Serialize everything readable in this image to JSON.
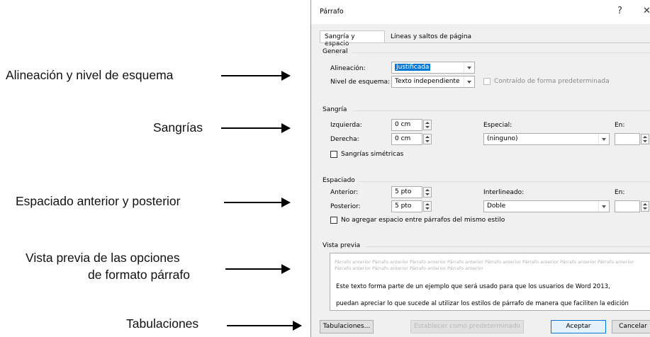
{
  "annotations": {
    "alineacion": "Alineación y nivel de esquema",
    "sangrias": "Sangrías",
    "espaciado": "Espaciado anterior y posterior",
    "vista_previa_1": "Vista previa de las opciones",
    "vista_previa_2": "de formato párrafo",
    "tabulaciones": "Tabulaciones"
  },
  "dialog": {
    "title": "Párrafo",
    "help": "?",
    "close": "✕",
    "tabs": [
      "Sangría y espacio",
      "Líneas y saltos de página"
    ],
    "general": {
      "heading": "General",
      "alineacion_label": "Alineación:",
      "alineacion_value": "Justificada",
      "nivel_label": "Nivel de esquema:",
      "nivel_value": "Texto independiente",
      "contraido_label": "Contraído de forma predeterminada"
    },
    "sangria": {
      "heading": "Sangría",
      "izquierda_label": "Izquierda:",
      "izquierda_value": "0 cm",
      "derecha_label": "Derecha:",
      "derecha_value": "0 cm",
      "especial_label": "Especial:",
      "especial_value": "(ninguno)",
      "en_label": "En:",
      "simetricas_label": "Sangrías simétricas"
    },
    "espaciado": {
      "heading": "Espaciado",
      "anterior_label": "Anterior:",
      "anterior_value": "5 pto",
      "posterior_label": "Posterior:",
      "posterior_value": "5 pto",
      "interlineado_label": "Interlineado:",
      "interlineado_value": "Doble",
      "en_label": "En:",
      "no_agregar_label": "No agregar espacio entre párrafos del mismo estilo"
    },
    "vista_previa": {
      "heading": "Vista previa",
      "grey_text": "Párrafo anterior Párrafo anterior Párrafo anterior Párrafo anterior Párrafo anterior Párrafo anterior Párrafo anterior Párrafo anterior Párrafo anterior Párrafo anterior Párrafo anterior Párrafo anterior",
      "line1": "Este texto forma parte de un ejemplo que será usado para que los usuarios de Word 2013,",
      "line2": "puedan apreciar lo que sucede al utilizar los estilos de párrafo de manera que faciliten la edición"
    },
    "buttons": {
      "tabulaciones": "Tabulaciones...",
      "predeterminar": "Establecer como predeterminado",
      "aceptar": "Aceptar",
      "cancelar": "Cancelar"
    }
  }
}
